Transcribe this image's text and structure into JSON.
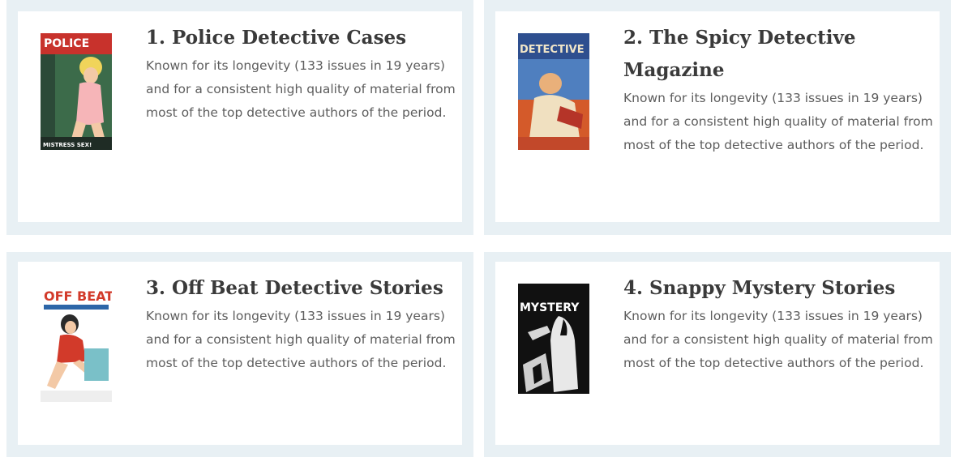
{
  "items": [
    {
      "title": "1. Police Detective Cases",
      "description": "Known for its longevity (133 issues in 19 years) and for a consistent high quality of material from most of the top detective authors of the period.",
      "cover_icon": "police-details-cover",
      "cover_text": [
        "POLICE",
        "MISTRESS SEX!"
      ]
    },
    {
      "title": "2. The Spicy Detective Magazine",
      "description": "Known for its longevity (133 issues in 19 years) and for a consistent high quality of material from most of the top detective authors of the period.",
      "cover_icon": "spicy-detective-cover",
      "cover_text": [
        "DETECTIVE"
      ]
    },
    {
      "title": "3. Off Beat Detective Stories",
      "description": "Known for its longevity (133 issues in 19 years) and for a consistent high quality of material from most of the top detective authors of the period.",
      "cover_icon": "off-beat-cover",
      "cover_text": [
        "OFF BEAT"
      ]
    },
    {
      "title": "4. Snappy Mystery Stories",
      "description": "Known for its longevity (133 issues in 19 years) and for a consistent high quality of material from most of the top detective authors of the period.",
      "cover_icon": "snappy-mystery-cover",
      "cover_text": [
        "MYSTERY"
      ]
    }
  ],
  "colors": {
    "card_border": "#e8f0f4",
    "title": "#3a3a3a",
    "body_text": "#5d5d5d"
  }
}
